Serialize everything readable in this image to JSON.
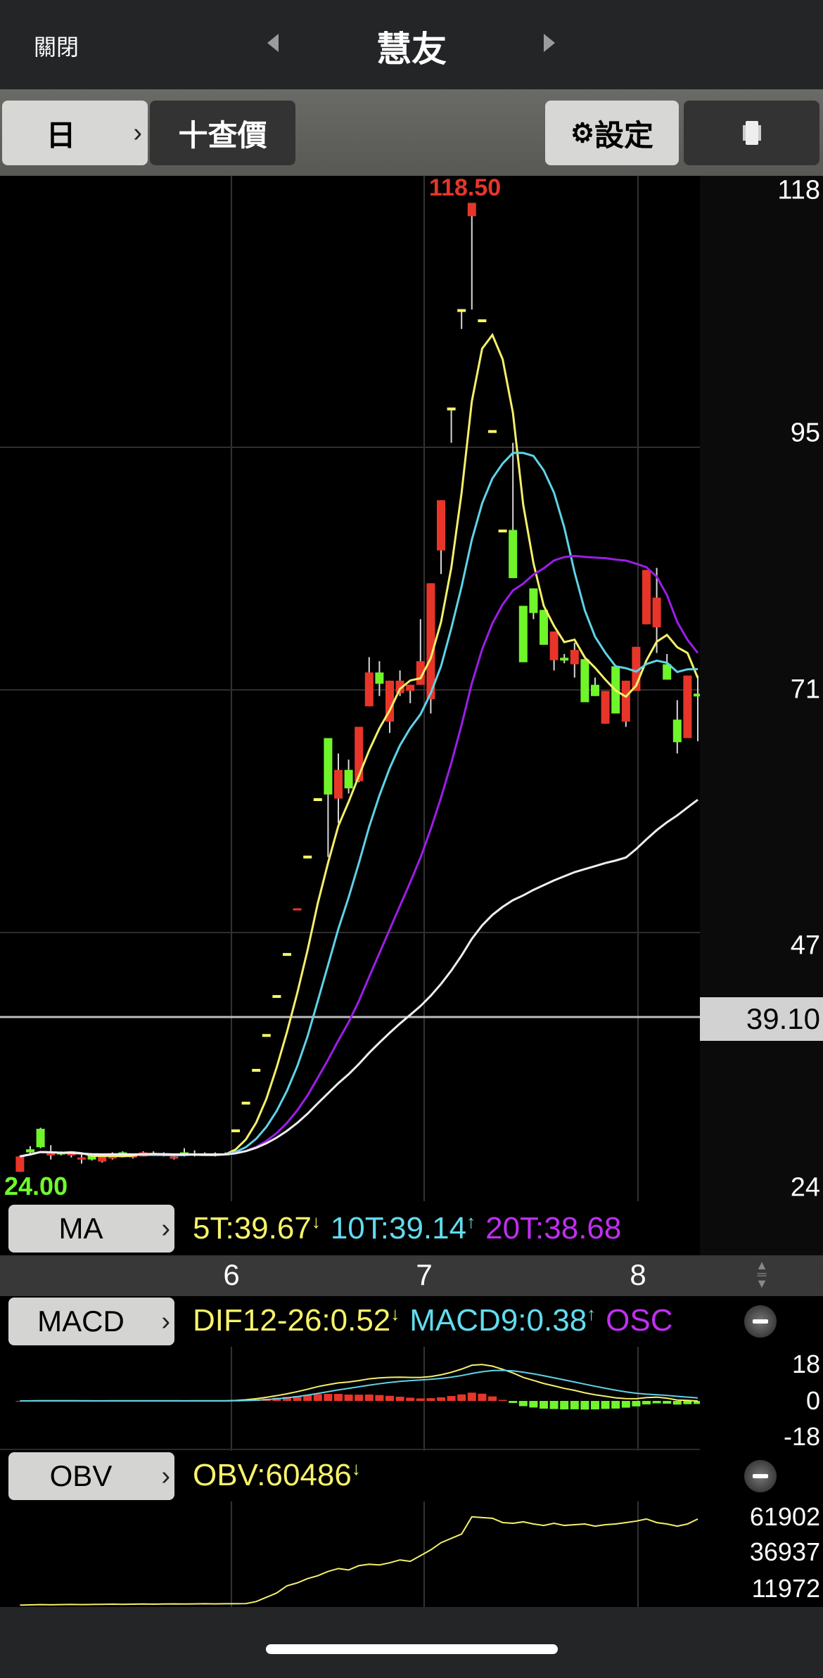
{
  "header": {
    "close_label": "關閉",
    "title": "慧友"
  },
  "toolbar": {
    "period_label": "日",
    "quote_label": "十查價",
    "settings_label": "設定",
    "rotate_icon": "rotate-icon"
  },
  "price_axis": {
    "labels": [
      "118",
      "95",
      "71",
      "47",
      "24"
    ],
    "current_price": "39.10"
  },
  "chart_labels": {
    "high": "118.50",
    "low": "24.00"
  },
  "ma_row": {
    "button": "MA",
    "values": [
      {
        "text": "5T:39.67",
        "color": "#f8f36a"
      },
      {
        "text": "10T:39.14",
        "color": "#62dcef"
      },
      {
        "text": "20T:38.68",
        "color": "#c02ff0"
      }
    ]
  },
  "date_axis": [
    "6",
    "7",
    "8"
  ],
  "macd_row": {
    "button": "MACD",
    "values": [
      {
        "text": "DIF12-26:0.52",
        "color": "#f8f36a"
      },
      {
        "text": "MACD9:0.38",
        "color": "#62dcef"
      },
      {
        "text": "OSC",
        "color": "#c02ff0"
      }
    ],
    "axis": [
      "18",
      "0",
      "-18"
    ]
  },
  "obv_row": {
    "button": "OBV",
    "value": "OBV:60486",
    "axis": [
      "61902",
      "36937",
      "11972"
    ]
  },
  "chart_data": {
    "type": "candlestick",
    "price_range": [
      24,
      118.5
    ],
    "ma_periods": [
      5,
      10,
      20,
      60
    ],
    "ma_colors": [
      "#f5f06a",
      "#5fd3e8",
      "#9b1ee8",
      "#eeeeee"
    ],
    "up_color": "#e8352a",
    "down_color": "#6ff52a",
    "limit_color": "#ffff66",
    "ohlc": [
      [
        24.0,
        25.6,
        24.0,
        25.5
      ],
      [
        26.2,
        26.5,
        25.8,
        25.9
      ],
      [
        28.2,
        28.3,
        26.3,
        26.4
      ],
      [
        25.6,
        26.6,
        25.2,
        25.8
      ],
      [
        25.9,
        26.0,
        25.6,
        25.7
      ],
      [
        25.6,
        25.9,
        25.4,
        25.8
      ],
      [
        25.3,
        25.8,
        24.8,
        25.4
      ],
      [
        25.7,
        25.8,
        25.1,
        25.2
      ],
      [
        25.0,
        25.7,
        24.9,
        25.6
      ],
      [
        25.3,
        25.9,
        25.2,
        25.8
      ],
      [
        25.9,
        26.0,
        25.5,
        25.6
      ],
      [
        25.4,
        25.8,
        25.3,
        25.7
      ],
      [
        25.5,
        26.0,
        25.5,
        25.9
      ],
      [
        25.7,
        26.0,
        25.6,
        25.8
      ],
      [
        25.8,
        25.9,
        25.5,
        25.6
      ],
      [
        25.4,
        25.6,
        25.2,
        25.5
      ],
      [
        25.9,
        26.3,
        25.5,
        25.6
      ],
      [
        25.6,
        26.1,
        25.5,
        25.8
      ],
      [
        25.8,
        25.9,
        25.6,
        25.7
      ],
      [
        25.8,
        25.9,
        25.5,
        25.6
      ],
      [
        25.7,
        25.9,
        25.6,
        25.8
      ],
      [
        28.0,
        28.0,
        28.0,
        28.0
      ],
      [
        30.7,
        30.7,
        30.7,
        30.7
      ],
      [
        33.9,
        33.9,
        33.9,
        33.9
      ],
      [
        37.3,
        37.3,
        37.3,
        37.3
      ],
      [
        41.1,
        41.1,
        41.1,
        41.1
      ],
      [
        45.2,
        45.2,
        45.2,
        45.2
      ],
      [
        49.5,
        49.7,
        49.5,
        49.7
      ],
      [
        54.7,
        54.7,
        54.7,
        54.7
      ],
      [
        60.3,
        60.3,
        60.3,
        60.3
      ],
      [
        66.3,
        66.3,
        54.7,
        60.8
      ],
      [
        60.4,
        64.8,
        58.0,
        63.2
      ],
      [
        63.2,
        64.2,
        60.9,
        61.4
      ],
      [
        62.1,
        67.4,
        62.0,
        67.4
      ],
      [
        69.4,
        74.2,
        69.4,
        72.7
      ],
      [
        72.7,
        73.8,
        70.4,
        71.6
      ],
      [
        67.9,
        71.9,
        66.8,
        71.9
      ],
      [
        70.7,
        72.9,
        70.4,
        71.9
      ],
      [
        70.9,
        71.5,
        69.7,
        71.5
      ],
      [
        71.5,
        77.9,
        71.5,
        73.8
      ],
      [
        70.1,
        81.4,
        68.7,
        81.4
      ],
      [
        84.6,
        89.5,
        82.3,
        89.5
      ],
      [
        98.4,
        98.4,
        95.1,
        98.4
      ],
      [
        108.0,
        108.0,
        106.2,
        108.0
      ],
      [
        117.2,
        118.5,
        108.1,
        118.5
      ],
      [
        107.0,
        107.0,
        107.0,
        107.0
      ],
      [
        96.2,
        96.2,
        96.2,
        96.2
      ],
      [
        86.5,
        86.5,
        86.5,
        86.5
      ],
      [
        86.6,
        95.1,
        81.9,
        81.9
      ],
      [
        79.2,
        79.2,
        73.7,
        73.7
      ],
      [
        80.9,
        80.9,
        77.9,
        78.5
      ],
      [
        78.8,
        78.8,
        75.4,
        75.4
      ],
      [
        73.9,
        76.7,
        72.9,
        76.7
      ],
      [
        74.0,
        74.5,
        73.6,
        74.0
      ],
      [
        73.5,
        75.6,
        72.2,
        74.9
      ],
      [
        74.0,
        74.0,
        69.8,
        69.8
      ],
      [
        71.5,
        72.2,
        70.4,
        70.4
      ],
      [
        67.7,
        70.9,
        67.7,
        70.9
      ],
      [
        73.3,
        73.3,
        68.7,
        68.7
      ],
      [
        67.9,
        71.9,
        67.4,
        71.9
      ],
      [
        70.9,
        75.2,
        70.9,
        75.2
      ],
      [
        77.4,
        82.7,
        77.4,
        82.7
      ],
      [
        77.1,
        82.9,
        74.6,
        80.0
      ],
      [
        73.5,
        74.5,
        72.0,
        72.0
      ],
      [
        68.1,
        70.0,
        64.8,
        65.9
      ],
      [
        66.3,
        72.4,
        66.3,
        72.4
      ],
      [
        70.5,
        72.4,
        66.0,
        70.5
      ]
    ],
    "month_starts": {
      "6": 21,
      "7": 40,
      "8": 60
    },
    "macd_range": [
      -18,
      18
    ],
    "obv": [
      500,
      700,
      900,
      800,
      900,
      1000,
      900,
      1000,
      1100,
      1200,
      1100,
      1200,
      1300,
      1200,
      1300,
      1400,
      1300,
      1400,
      1500,
      1400,
      1500,
      1500,
      1600,
      3000,
      6000,
      9000,
      14000,
      16000,
      19000,
      21000,
      24000,
      26000,
      25000,
      28000,
      29000,
      28500,
      30000,
      32000,
      31000,
      35000,
      39000,
      44000,
      47000,
      50000,
      62000,
      61500,
      61000,
      58000,
      57500,
      58500,
      57000,
      56000,
      57500,
      56000,
      56500,
      57000,
      55500,
      56500,
      57000,
      58000,
      59000,
      60500,
      58000,
      57000,
      55500,
      57000,
      60486
    ],
    "obv_range": [
      11972,
      61902
    ]
  }
}
